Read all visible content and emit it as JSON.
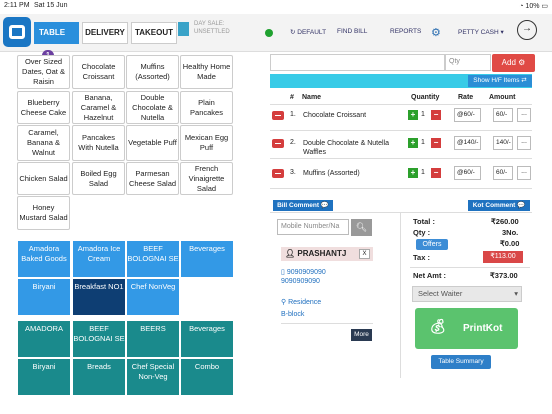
{
  "status_bar": {
    "time": "2:11 PM",
    "date": "Sat 15 Jun",
    "battery": "10%"
  },
  "nav": {
    "tabs": [
      {
        "label": "TABLE",
        "badge": "1"
      },
      {
        "label": "DELIVERY"
      },
      {
        "label": "TAKEOUT"
      }
    ],
    "day_sale_line1": "DAY SALE:",
    "day_sale_line2": "UNSETTLED",
    "links": [
      "DEFAULT",
      "FIND BILL",
      "REPORTS",
      "PETTY CASH"
    ]
  },
  "items": [
    "Over Sized Dates, Oat & Raisin",
    "Chocolate Croissant",
    "Muffins (Assorted)",
    "Healthy Home Made",
    "Blueberry Cheese Cake",
    "Banana, Caramel & Hazelnut",
    "Double Chocolate & Nutella",
    "Plain Pancakes",
    "Caramel, Banana & Walnut",
    "Pancakes With Nutella",
    "Vegetable Puff",
    "Mexican Egg Puff",
    "Chicken Salad",
    "Boiled Egg Salad",
    "Parmesan Cheese Salad",
    "French Vinaigrette Salad",
    "Honey Mustard Salad"
  ],
  "subcategories": [
    {
      "label": "Amadora Baked Goods",
      "selected": false
    },
    {
      "label": "Amadora Ice Cream",
      "selected": false
    },
    {
      "label": "BEEF BOLOGNAI SE",
      "selected": false
    },
    {
      "label": "Beverages",
      "selected": false
    },
    {
      "label": "Biryani",
      "selected": false
    },
    {
      "label": "Breakfast NO1",
      "selected": true
    },
    {
      "label": "Chef NonVeg",
      "selected": false
    }
  ],
  "categories": [
    "AMADORA",
    "BEEF BOLOGNAI SE",
    "BEERS",
    "Beverages",
    "Biryani",
    "Breads",
    "Chef Special Non-Veg",
    "Combo"
  ],
  "order": {
    "qty_placeholder": "Qty",
    "add_label": "Add",
    "hf_label": "Show H/F Items",
    "headers": [
      "#",
      "Name",
      "Quantity",
      "Rate",
      "Amount"
    ],
    "rows": [
      {
        "num": "1.",
        "name": "Chocolate Croissant",
        "qty": "1",
        "rate": "@60/-",
        "amount": "60/-"
      },
      {
        "num": "2.",
        "name": "Double Chocolate & Nutella Waffles",
        "qty": "1",
        "rate": "@140/-",
        "amount": "140/-"
      },
      {
        "num": "3.",
        "name": "Muffins (Assorted)",
        "qty": "1",
        "rate": "@60/-",
        "amount": "60/-"
      }
    ],
    "bill_comment": "Bill Comment",
    "kot_comment": "Kot Comment"
  },
  "customer": {
    "mobile_placeholder": "Mobile Number/Na",
    "name": "PRASHANTJ",
    "phone1": "9090909090",
    "phone2": "9090909090",
    "address_type": "Residence",
    "address": "B-block",
    "more_label": "More"
  },
  "totals": {
    "total_label": "Total :",
    "total": "₹260.00",
    "qty_label": "Qty :",
    "qty": "3No.",
    "offers_label": "Offers",
    "offers": "₹0.00",
    "tax_label": "Tax :",
    "tax": "₹113.00",
    "net_label": "Net Amt :",
    "net": "₹373.00",
    "waiter_placeholder": "Select Waiter",
    "printkot_label": "PrintKot",
    "summary_label": "Table Summary"
  },
  "colors": {
    "primary": "#2a8fdc",
    "danger": "#e04a45",
    "teal": "#1a8a8c",
    "green": "#5bc36e"
  }
}
